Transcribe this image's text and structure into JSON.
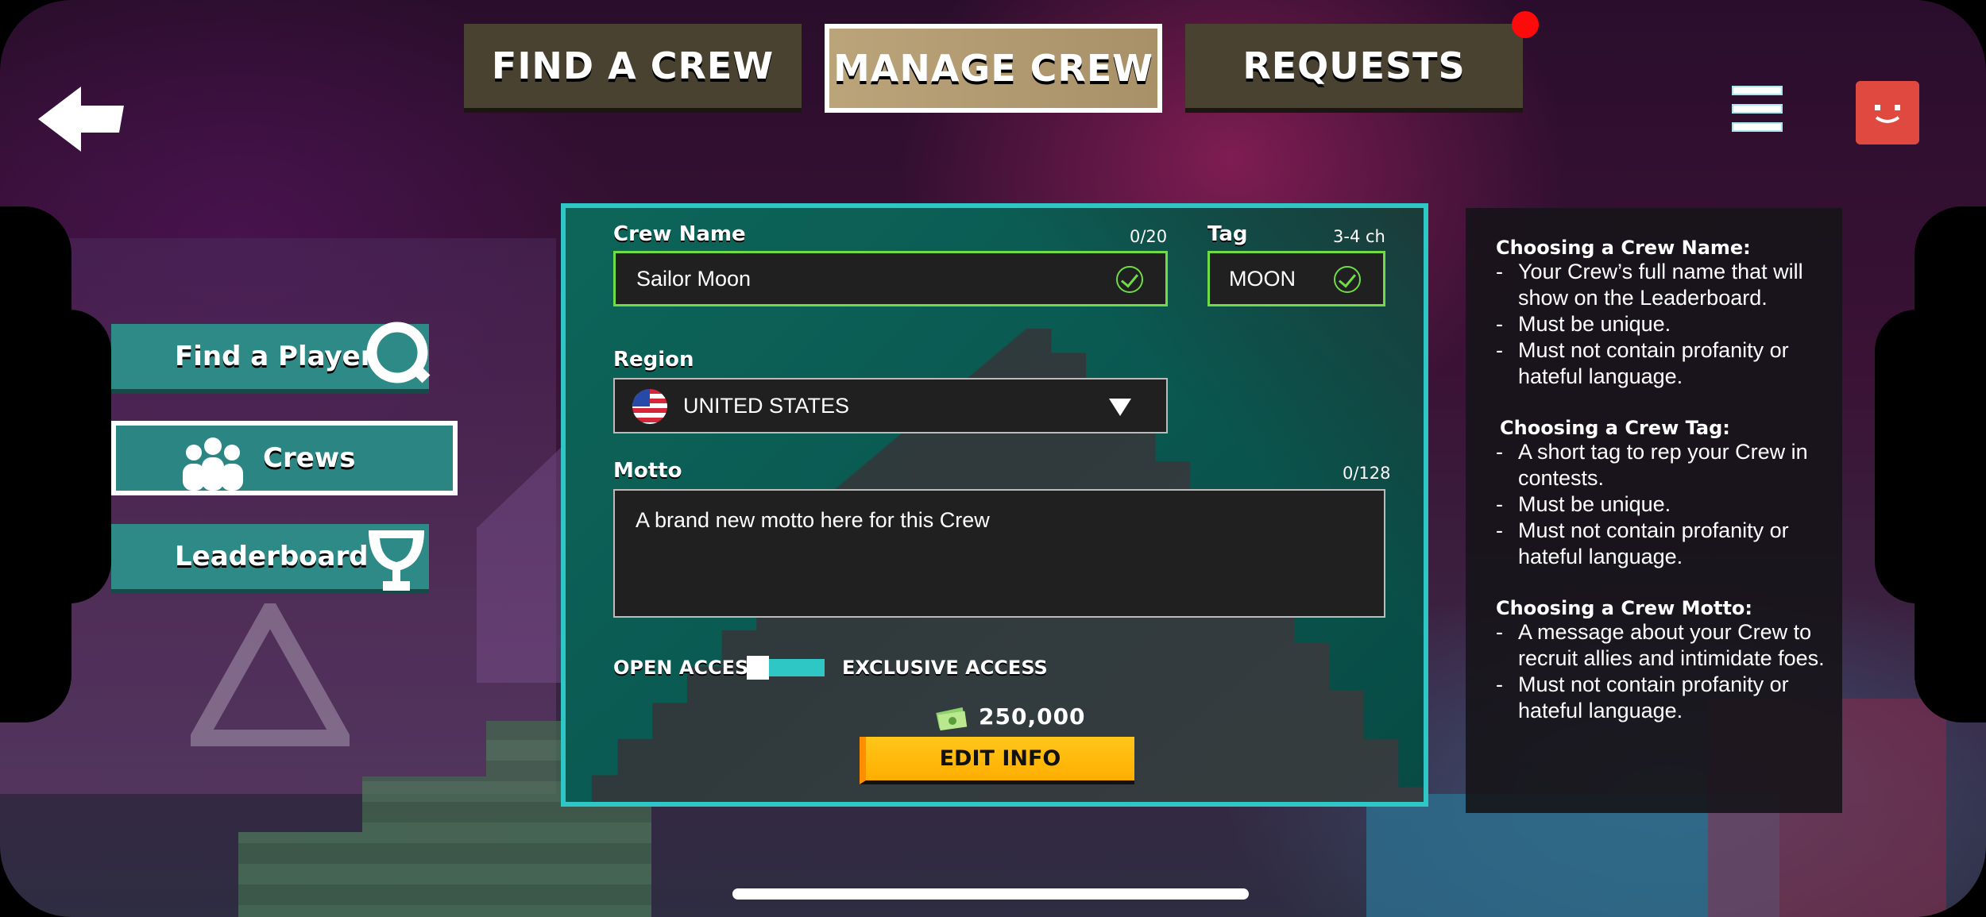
{
  "tabs": [
    {
      "label": "FIND A CREW",
      "active": false
    },
    {
      "label": "MANAGE CREW",
      "active": true
    },
    {
      "label": "REQUESTS",
      "active": false
    }
  ],
  "nav": {
    "find_player": "Find a Player",
    "crews": "Crews",
    "leaderboard": "Leaderboard"
  },
  "form": {
    "crew_name": {
      "label": "Crew Name",
      "counter": "0/20",
      "value": "Sailor Moon"
    },
    "tag": {
      "label": "Tag",
      "counter": "3-4 ch",
      "value": "MOON"
    },
    "region": {
      "label": "Region",
      "value": "UNITED STATES"
    },
    "motto": {
      "label": "Motto",
      "counter": "0/128",
      "value": "A brand new motto here for this Crew"
    },
    "access": {
      "open_label": "OPEN ACCESS",
      "exclusive_label": "EXCLUSIVE ACCESS",
      "state": "open"
    },
    "cost": "250,000",
    "edit_button": "EDIT INFO"
  },
  "info": {
    "sections": [
      {
        "title": "Choosing a Crew Name:",
        "items": [
          "Your Crew’s full name that will show on the Leaderboard.",
          "Must be unique.",
          "Must not contain profanity or hateful language."
        ]
      },
      {
        "title": "Choosing a Crew Tag:",
        "items": [
          "A short tag to rep your Crew in contests.",
          "Must be unique.",
          "Must not contain profanity or hateful language."
        ]
      },
      {
        "title": "Choosing a Crew Motto:",
        "items": [
          "A message about your Crew to recruit allies and intimidate foes.",
          "Must not contain profanity or hateful language."
        ]
      }
    ]
  },
  "colors": {
    "accent": "#2fc6c6",
    "valid": "#6fdc46",
    "button": "#ffb300",
    "notification": "#ff0a0a"
  },
  "icons": [
    "back-arrow-icon",
    "hamburger-menu-icon",
    "avatar-icon",
    "search-icon",
    "crew-people-icon",
    "trophy-icon",
    "check-icon",
    "us-flag-icon",
    "dropdown-caret-icon",
    "cash-icon"
  ]
}
